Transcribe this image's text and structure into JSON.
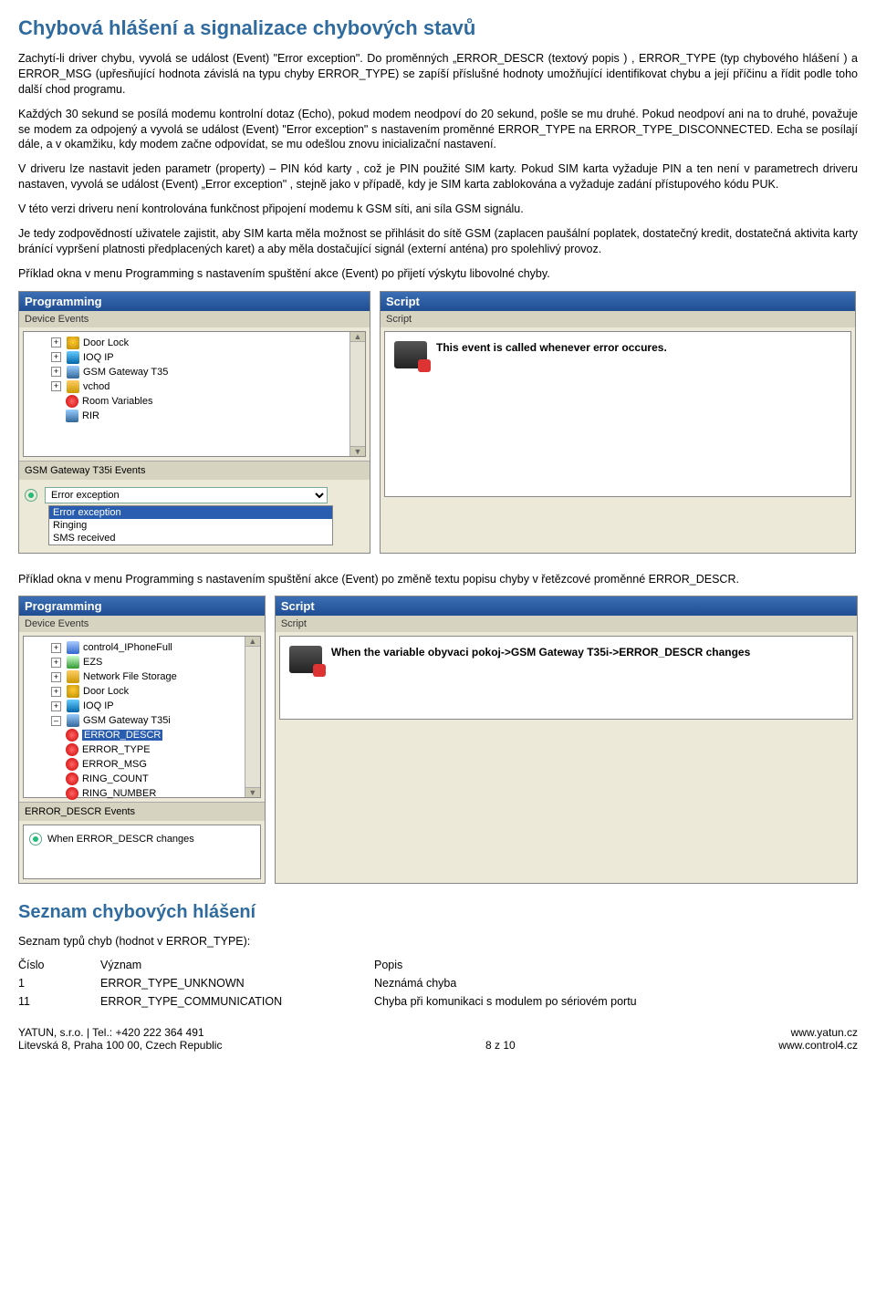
{
  "h1": "Chybová hlášení a signalizace chybových stavů",
  "p1": "Zachytí-li driver chybu, vyvolá se událost (Event) \"Error exception\". Do proměnných „ERROR_DESCR (textový popis ) , ERROR_TYPE (typ chybového hlášení ) a ERROR_MSG (upřesňující hodnota závislá na typu chyby ERROR_TYPE) se zapíší příslušné hodnoty umožňující identifikovat chybu a její příčinu a řídit podle toho další chod programu.",
  "p2": "Každých 30 sekund se posílá modemu kontrolní dotaz (Echo), pokud modem neodpoví do 20 sekund, pošle se mu druhé. Pokud neodpoví ani na to druhé, považuje se modem za odpojený a vyvolá se událost (Event) \"Error exception\" s nastavením proměnné ERROR_TYPE na ERROR_TYPE_DISCONNECTED. Echa se posílají dále, a v okamžiku, kdy modem začne odpovídat, se mu odešlou znovu inicializační nastavení.",
  "p3": "V driveru lze nastavit jeden parametr (property) – PIN kód karty , což je PIN použité SIM karty. Pokud SIM karta vyžaduje PIN a ten není v parametrech driveru nastaven, vyvolá se událost (Event) „Error exception\" , stejně jako v případě, kdy je SIM karta zablokována a vyžaduje zadání přístupového kódu PUK.",
  "p4": "V této verzi driveru není kontrolována funkčnost připojení modemu k GSM síti, ani síla GSM signálu.",
  "p5": "Je tedy zodpovědností uživatele zajistit, aby SIM karta měla možnost se přihlásit do sítě GSM (zaplacen paušální poplatek, dostatečný kredit, dostatečná aktivita karty bránící vypršení platnosti předplacených karet) a aby měla dostačující signál (externí anténa) pro spolehlivý provoz.",
  "p6": "Příklad okna v menu Programming s nastavením spuštění akce (Event) po přijetí výskytu libovolné chyby.",
  "panel1": {
    "prog_title": "Programming",
    "device_events": "Device Events",
    "tree": [
      "Door Lock",
      "IOQ IP",
      "GSM Gateway T35",
      "vchod",
      "Room Variables",
      "RIR"
    ],
    "events_title": "GSM Gateway T35i Events",
    "combo_value": "Error exception",
    "options": [
      "Error exception",
      "Ringing",
      "SMS received"
    ],
    "script_title": "Script",
    "script_sub": "Script",
    "script_text": "This event is called whenever error occures."
  },
  "p7": "Příklad okna v menu Programming s nastavením spuštění akce (Event) po změně textu popisu chyby v řetězcové proměnné ERROR_DESCR.",
  "panel2": {
    "prog_title": "Programming",
    "device_events": "Device Events",
    "tree": [
      "control4_IPhoneFull",
      "EZS",
      "Network File Storage",
      "Door Lock",
      "IOQ IP",
      "GSM Gateway T35i"
    ],
    "vars": [
      "ERROR_DESCR",
      "ERROR_TYPE",
      "ERROR_MSG",
      "RING_COUNT",
      "RING_NUMBER"
    ],
    "events_title": "ERROR_DESCR Events",
    "event_item": "When ERROR_DESCR changes",
    "script_title": "Script",
    "script_sub": "Script",
    "script_text": "When the variable obyvaci pokoj->GSM Gateway T35i->ERROR_DESCR changes"
  },
  "h2": "Seznam chybových hlášení",
  "p8": "Seznam typů chyb (hodnot v ERROR_TYPE):",
  "th": [
    "Číslo",
    "Význam",
    "Popis"
  ],
  "rows": [
    [
      "1",
      "ERROR_TYPE_UNKNOWN",
      "Neznámá chyba"
    ],
    [
      "11",
      "ERROR_TYPE_COMMUNICATION",
      "Chyba při komunikaci s modulem po sériovém portu"
    ]
  ],
  "footer": {
    "l1": "YATUN, s.r.o. | Tel.: +420 222 364 491",
    "l2": "Litevská 8, Praha 100 00, Czech Republic",
    "c": "8 z 10",
    "r1": "www.yatun.cz",
    "r2": "www.control4.cz"
  }
}
